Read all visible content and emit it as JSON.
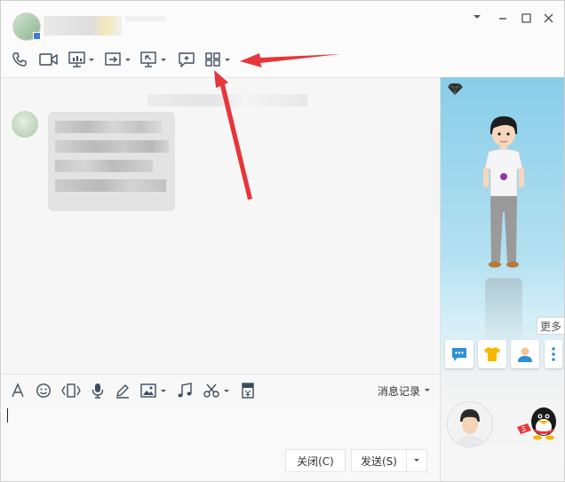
{
  "window": {
    "controls": [
      "chevron-down-icon",
      "minimize-icon",
      "maximize-icon",
      "close-icon"
    ]
  },
  "toolbar": {
    "icons": [
      "phone-icon",
      "video-icon",
      "screen-share-icon",
      "file-transfer-icon",
      "remote-desktop-icon",
      "add-note-icon",
      "app-grid-icon"
    ]
  },
  "input_toolbar": {
    "history_label": "消息记录"
  },
  "footer": {
    "close_label": "关闭(C)",
    "send_label": "发送(S)"
  },
  "sidebar": {
    "more_label": "更多"
  },
  "colors": {
    "accent": "#2d8fd8",
    "arrow": "#e8353a",
    "sidebar_sky": "#9fd6ec"
  }
}
